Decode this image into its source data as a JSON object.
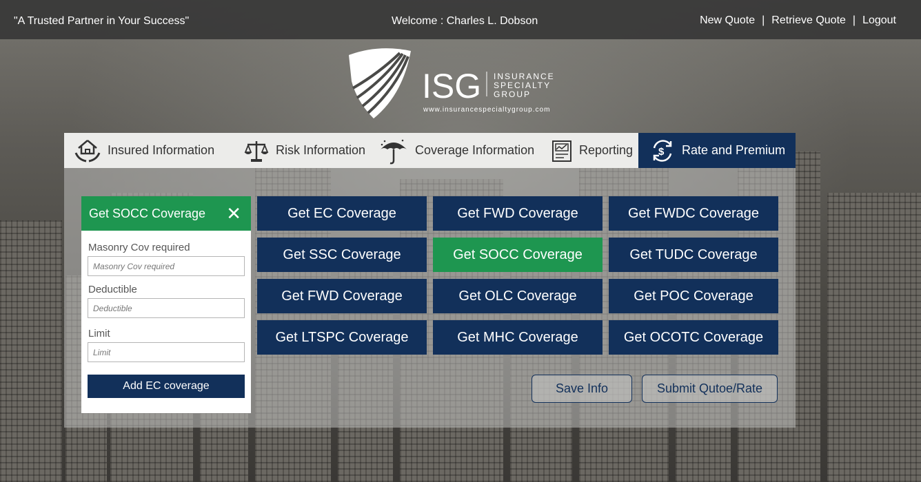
{
  "header": {
    "tagline": "\"A Trusted Partner in Your Success\"",
    "welcome": "Welcome : Charles L. Dobson",
    "links": {
      "new_quote": "New Quote",
      "retrieve_quote": "Retrieve Quote",
      "logout": "Logout",
      "separator": "|"
    }
  },
  "logo": {
    "mark": "ISG",
    "line1": "INSURANCE",
    "line2": "SPECIALTY",
    "line3": "GROUP",
    "url": "www.insurancespecialtygroup.com"
  },
  "tabs": [
    {
      "label": "Insured Information",
      "icon": "home-hands-icon"
    },
    {
      "label": "Risk Information",
      "icon": "scales-icon"
    },
    {
      "label": "Coverage Information",
      "icon": "umbrella-icon"
    },
    {
      "label": "Reporting",
      "icon": "report-icon"
    },
    {
      "label": "Rate and Premium",
      "icon": "dollar-cycle-icon"
    }
  ],
  "socc_panel": {
    "title": "Get SOCC Coverage",
    "fields": [
      {
        "label": "Masonry Cov required",
        "placeholder": "Masonry Cov required"
      },
      {
        "label": "Deductible",
        "placeholder": "Deductible"
      },
      {
        "label": "Limit",
        "placeholder": "Limit"
      }
    ],
    "add_button": "Add EC coverage"
  },
  "coverages": [
    "Get EC Coverage",
    "Get FWD Coverage",
    "Get FWDC Coverage",
    "Get SSC Coverage",
    "Get SOCC Coverage",
    "Get TUDC Coverage",
    "Get FWD Coverage",
    "Get OLC Coverage",
    "Get POC Coverage",
    "Get LTSPC Coverage",
    "Get MHC Coverage",
    "Get OCOTC Coverage"
  ],
  "actions": {
    "save": "Save Info",
    "submit": "Submit Qutoe/Rate"
  },
  "colors": {
    "navy": "#12305a",
    "green": "#1e9650"
  }
}
